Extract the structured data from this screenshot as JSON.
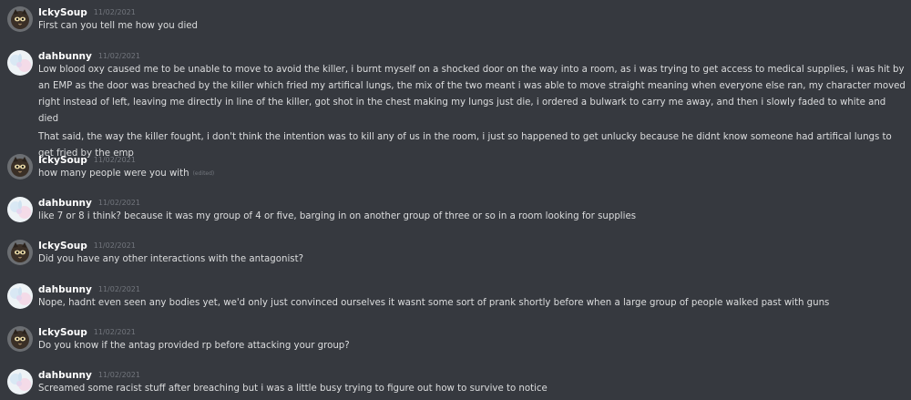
{
  "messages": [
    {
      "author": "IckySoup",
      "avatar_icon": "dark-cat-avatar-icon",
      "timestamp": "11/02/2021",
      "lines": [
        "First can you tell me how you died"
      ]
    },
    {
      "author": "dahbunny",
      "avatar_icon": "pastel-bunny-avatar-icon",
      "timestamp": "11/02/2021",
      "lines": [
        "Low blood oxy caused me to be unable to move to avoid the killer, i burnt myself on a shocked door on the way into a room, as i was trying to get access to medical supplies, i was hit by an EMP as the door was breached by the killer which fried my artifical lungs, the mix of the two meant i was able to move straight meaning when everyone else ran, my character moved right instead of left, leaving me directly in line of the killer, got shot in the chest making my lungs just die, i ordered a bulwark to carry me away, and then i slowly faded to white and died",
        "That said, the way the killer fought, i don't think the intention was to kill any of us in the room, i just so happened to get unlucky because he didnt know someone had artifical lungs to get fried by the emp"
      ]
    },
    {
      "author": "IckySoup",
      "avatar_icon": "dark-cat-avatar-icon",
      "timestamp": "11/02/2021",
      "lines": [
        "how many people were you with"
      ],
      "edited": "(edited)"
    },
    {
      "author": "dahbunny",
      "avatar_icon": "pastel-bunny-avatar-icon",
      "timestamp": "11/02/2021",
      "lines": [
        "like 7 or 8 i think? because it was my group of 4 or five, barging in on another group of three or so in a room looking for supplies"
      ]
    },
    {
      "author": "IckySoup",
      "avatar_icon": "dark-cat-avatar-icon",
      "timestamp": "11/02/2021",
      "lines": [
        "Did you have any other interactions with the antagonist?"
      ]
    },
    {
      "author": "dahbunny",
      "avatar_icon": "pastel-bunny-avatar-icon",
      "timestamp": "11/02/2021",
      "lines": [
        "Nope, hadnt even seen any bodies yet, we'd only just convinced ourselves it wasnt some sort of prank shortly before when a large group of people walked past with guns"
      ]
    },
    {
      "author": "IckySoup",
      "avatar_icon": "dark-cat-avatar-icon",
      "timestamp": "11/02/2021",
      "lines": [
        "Do you know if the antag provided rp before attacking your group?"
      ]
    },
    {
      "author": "dahbunny",
      "avatar_icon": "pastel-bunny-avatar-icon",
      "timestamp": "11/02/2021",
      "lines": [
        "Screamed some racist stuff after breaching but i was a little busy trying to figure out how to survive to notice"
      ]
    }
  ]
}
